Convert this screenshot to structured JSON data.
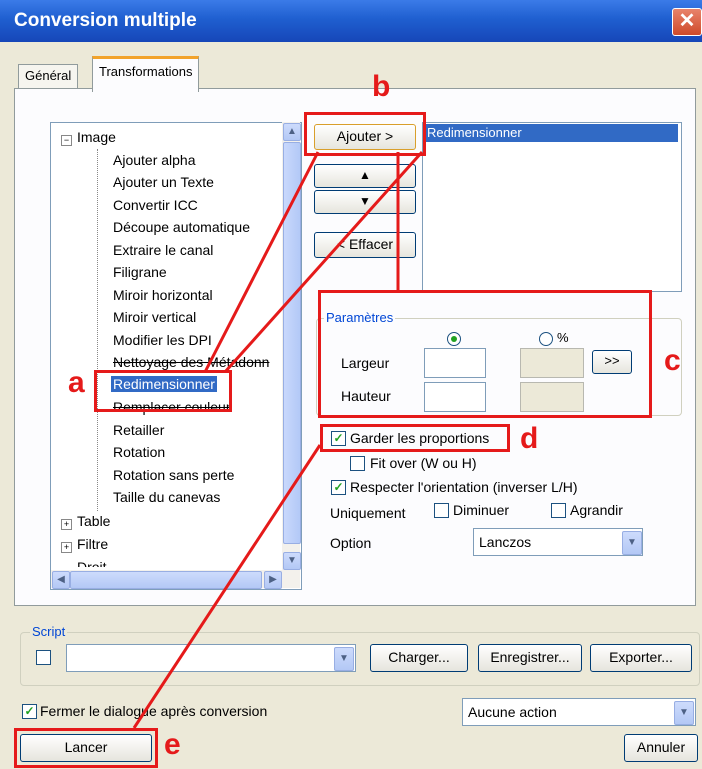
{
  "window": {
    "title": "Conversion multiple",
    "close_glyph": "✕"
  },
  "tabs": {
    "general": "Général",
    "transformations": "Transformations"
  },
  "tree": {
    "root_label": "Image",
    "items": [
      "Ajouter alpha",
      "Ajouter un Texte",
      "Convertir ICC",
      "Découpe automatique",
      "Extraire le canal",
      "Filigrane",
      "Miroir horizontal",
      "Miroir vertical",
      "Modifier les DPI",
      "Nettoyage des Métadonn",
      "Redimensionner",
      "Remplacer couleur",
      "Retailler",
      "Rotation",
      "Rotation sans perte",
      "Taille du canevas"
    ],
    "selected": "Redimensionner",
    "groups": [
      "Table",
      "Filtre",
      "Droit"
    ]
  },
  "buttons": {
    "add": "Ajouter >",
    "up": "▲",
    "down": "▼",
    "clear": "< Effacer",
    "more": ">>",
    "load": "Charger...",
    "save": "Enregistrer...",
    "export": "Exporter...",
    "run": "Lancer",
    "cancel": "Annuler"
  },
  "operations": [
    "Redimensionner"
  ],
  "params": {
    "group_label": "Paramètres",
    "percent_label": "%",
    "width_label": "Largeur",
    "height_label": "Hauteur",
    "keep_ratio": "Garder les proportions",
    "fit_over": "Fit over (W ou H)",
    "respect_orientation": "Respecter l'orientation (inverser L/H)",
    "only_label": "Uniquement",
    "decrease": "Diminuer",
    "increase": "Agrandir",
    "option_label": "Option",
    "option_value": "Lanczos"
  },
  "script": {
    "group_label": "Script",
    "value": ""
  },
  "footer": {
    "close_after": "Fermer le dialogue après conversion",
    "action_value": "Aucune action"
  },
  "annotations": {
    "a": "a",
    "b": "b",
    "c": "c",
    "d": "d",
    "e": "e"
  },
  "colors": {
    "annotation": "#e51a1a",
    "accent": "#21a121",
    "selection": "#316ac5"
  }
}
